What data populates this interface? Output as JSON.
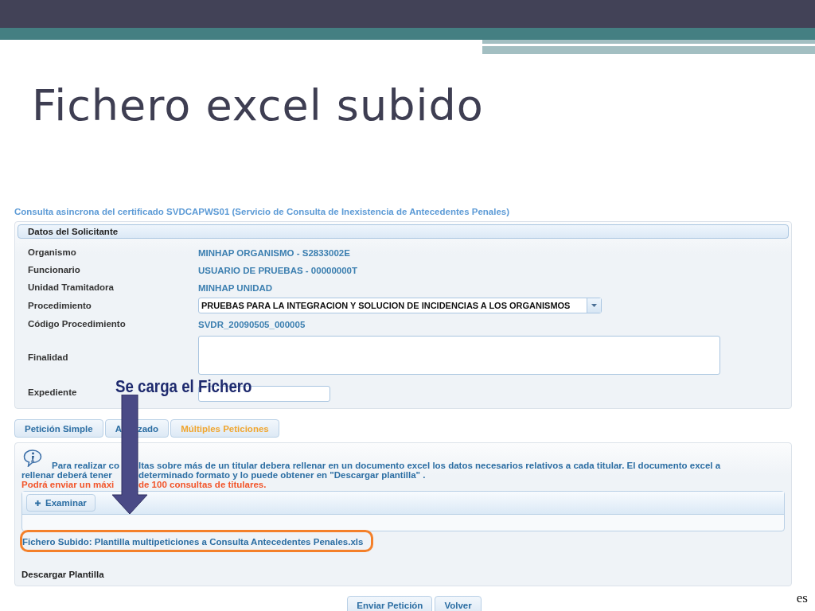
{
  "slide": {
    "title": "Fichero excel subido",
    "language_tag": "es"
  },
  "annotation": {
    "text": "Se carga el Fichero"
  },
  "form": {
    "heading": "Consulta asincrona del certificado SVDCAPWS01 (Servicio de Consulta de Inexistencia de Antecedentes Penales)",
    "panel_title": "Datos del Solicitante",
    "fields": [
      {
        "kind": "text",
        "label": "Organismo",
        "value": "MINHAP ORGANISMO - S2833002E"
      },
      {
        "kind": "text",
        "label": "Funcionario",
        "value": "USUARIO DE PRUEBAS - 00000000T"
      },
      {
        "kind": "text",
        "label": "Unidad Tramitadora",
        "value": "MINHAP UNIDAD"
      },
      {
        "kind": "select",
        "label": "Procedimiento",
        "value": "PRUEBAS PARA LA INTEGRACION Y SOLUCION DE INCIDENCIAS A LOS ORGANISMOS"
      },
      {
        "kind": "text",
        "label": "Código Procedimiento",
        "value": "SVDR_20090505_000005"
      },
      {
        "kind": "textarea",
        "label": "Finalidad"
      },
      {
        "kind": "input",
        "label": "Expediente"
      }
    ]
  },
  "tabs": [
    {
      "label_parts": [
        "Petición Simple"
      ],
      "selected": false
    },
    {
      "label_parts": [
        "A",
        "zado"
      ],
      "selected": false
    },
    {
      "label_parts": [
        "Múltiples Peticiones"
      ],
      "selected": true
    }
  ],
  "multi_panel": {
    "info_lines": [
      {
        "parts": [
          "Para realizar co",
          "ltas sobre más de un titular debera rellenar en un documento excel los datos necesarios relativos a cada titular. El documento excel a"
        ]
      },
      {
        "parts": [
          "rellenar deberá tener",
          "determinado formato y lo puede obtener en \"Descargar plantilla\" ."
        ]
      }
    ],
    "warning_parts": [
      "Podrá enviar un máxi",
      "de 100 consultas de titulares."
    ],
    "browse_button": "Examinar",
    "uploaded_file": "Fichero Subido: Plantilla multipeticiones a Consulta Antecedentes Penales.xls",
    "download_link": "Descargar Plantilla"
  },
  "buttons": [
    "Enviar Petición",
    "Volver"
  ]
}
